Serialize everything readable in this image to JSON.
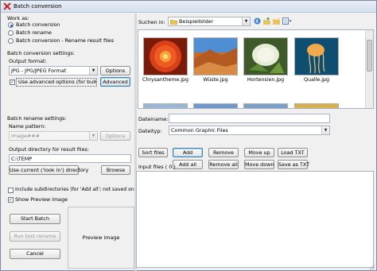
{
  "window": {
    "title": "Batch conversion"
  },
  "work_as": {
    "label": "Work as:",
    "options": [
      "Batch conversion",
      "Batch rename",
      "Batch conversion - Rename result files"
    ],
    "selected": 0
  },
  "conversion": {
    "label": "Batch conversion settings:",
    "format_label": "Output format:",
    "format_value": "JPG - JPG/JPEG Format",
    "options_button": "Options",
    "advanced_check": "Use advanced options (for bulk resize...",
    "advanced_button": "Advanced"
  },
  "rename": {
    "label": "Batch rename settings:",
    "pattern_label": "Name pattern:",
    "pattern_value": "image###",
    "options_button": "Options"
  },
  "output": {
    "label": "Output directory for result files:",
    "dir_value": "C:\\TEMP",
    "use_current_button": "Use current ('look in') directory",
    "browse_button": "Browse"
  },
  "checks": {
    "subdirs": "Include subdirectories (for 'Add all'; not saved on exit)",
    "preview": "Show Preview image"
  },
  "actions": {
    "start": "Start Batch",
    "test": "Run test rename",
    "cancel": "Cancel"
  },
  "preview": {
    "label": "Preview image"
  },
  "browser": {
    "look_in_label": "Suchen in:",
    "look_in_value": "Beispielbilder",
    "files": [
      {
        "name": "Chrysantheme.jpg",
        "icon": "chrysanthemum-thumbnail"
      },
      {
        "name": "Wüste.jpg",
        "icon": "desert-thumbnail"
      },
      {
        "name": "Hortensien.jpg",
        "icon": "hydrangea-thumbnail"
      },
      {
        "name": "Qualle.jpg",
        "icon": "jellyfish-thumbnail"
      }
    ],
    "filename_label": "Dateiname:",
    "filename_value": "",
    "filetype_label": "Dateityp:",
    "filetype_value": "Common Graphic Files"
  },
  "list": {
    "sort_button": "Sort files",
    "add_button": "Add",
    "remove_button": "Remove",
    "move_up_button": "Move up",
    "load_button": "Load TXT",
    "add_all_button": "Add all",
    "remove_all_button": "Remove all",
    "move_down_button": "Move down",
    "save_button": "Save as TXT",
    "input_files_label": "Input files ( 0 )"
  },
  "colors": {
    "accent": "#1f5ea8",
    "title_icon": "#c0272d"
  }
}
